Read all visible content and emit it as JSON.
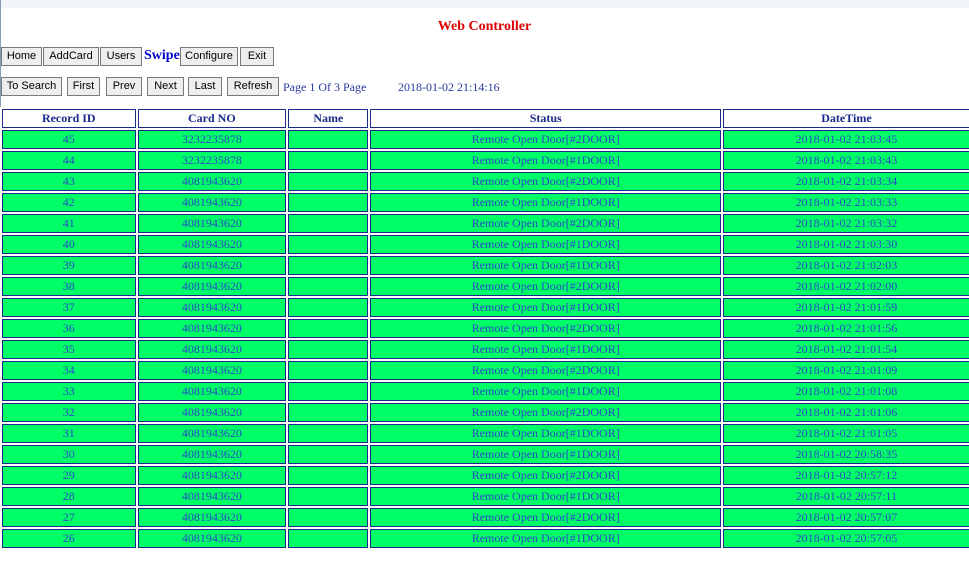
{
  "app": {
    "title": "Web Controller"
  },
  "nav": {
    "home": "Home",
    "addcard": "AddCard",
    "users": "Users",
    "current": "Swipe",
    "configure": "Configure",
    "exit": "Exit"
  },
  "toolbar": {
    "to_search": "To Search",
    "first": "First",
    "prev": "Prev",
    "next": "Next",
    "last": "Last",
    "refresh": "Refresh",
    "page_info": "Page 1 Of 3 Page",
    "clock": "2018-01-02 21:14:16"
  },
  "table": {
    "headers": [
      "Record ID",
      "Card NO",
      "Name",
      "Status",
      "DateTime"
    ],
    "rows": [
      [
        "45",
        "3232235878",
        "",
        "Remote Open Door[#2DOOR]",
        "2018-01-02 21:03:45"
      ],
      [
        "44",
        "3232235878",
        "",
        "Remote Open Door[#1DOOR]",
        "2018-01-02 21:03:43"
      ],
      [
        "43",
        "4081943620",
        "",
        "Remote Open Door[#2DOOR]",
        "2018-01-02 21:03:34"
      ],
      [
        "42",
        "4081943620",
        "",
        "Remote Open Door[#1DOOR]",
        "2018-01-02 21:03:33"
      ],
      [
        "41",
        "4081943620",
        "",
        "Remote Open Door[#2DOOR]",
        "2018-01-02 21:03:32"
      ],
      [
        "40",
        "4081943620",
        "",
        "Remote Open Door[#1DOOR]",
        "2018-01-02 21:03:30"
      ],
      [
        "39",
        "4081943620",
        "",
        "Remote Open Door[#1DOOR]",
        "2018-01-02 21:02:03"
      ],
      [
        "38",
        "4081943620",
        "",
        "Remote Open Door[#2DOOR]",
        "2018-01-02 21:02:00"
      ],
      [
        "37",
        "4081943620",
        "",
        "Remote Open Door[#1DOOR]",
        "2018-01-02 21:01:59"
      ],
      [
        "36",
        "4081943620",
        "",
        "Remote Open Door[#2DOOR]",
        "2018-01-02 21:01:56"
      ],
      [
        "35",
        "4081943620",
        "",
        "Remote Open Door[#1DOOR]",
        "2018-01-02 21:01:54"
      ],
      [
        "34",
        "4081943620",
        "",
        "Remote Open Door[#2DOOR]",
        "2018-01-02 21:01:09"
      ],
      [
        "33",
        "4081943620",
        "",
        "Remote Open Door[#1DOOR]",
        "2018-01-02 21:01:08"
      ],
      [
        "32",
        "4081943620",
        "",
        "Remote Open Door[#2DOOR]",
        "2018-01-02 21:01:06"
      ],
      [
        "31",
        "4081943620",
        "",
        "Remote Open Door[#1DOOR]",
        "2018-01-02 21:01:05"
      ],
      [
        "30",
        "4081943620",
        "",
        "Remote Open Door[#1DOOR]",
        "2018-01-02 20:58:35"
      ],
      [
        "29",
        "4081943620",
        "",
        "Remote Open Door[#2DOOR]",
        "2018-01-02 20:57:12"
      ],
      [
        "28",
        "4081943620",
        "",
        "Remote Open Door[#1DOOR]",
        "2018-01-02 20:57:11"
      ],
      [
        "27",
        "4081943620",
        "",
        "Remote Open Door[#2DOOR]",
        "2018-01-02 20:57:07"
      ],
      [
        "26",
        "4081943620",
        "",
        "Remote Open Door[#1DOOR]",
        "2018-01-02 20:57:05"
      ]
    ]
  },
  "colors": {
    "title": "#dd0000",
    "row_background": "#00ff66",
    "cell_text": "#2a47c8",
    "header_text": "#1a2a8a"
  }
}
